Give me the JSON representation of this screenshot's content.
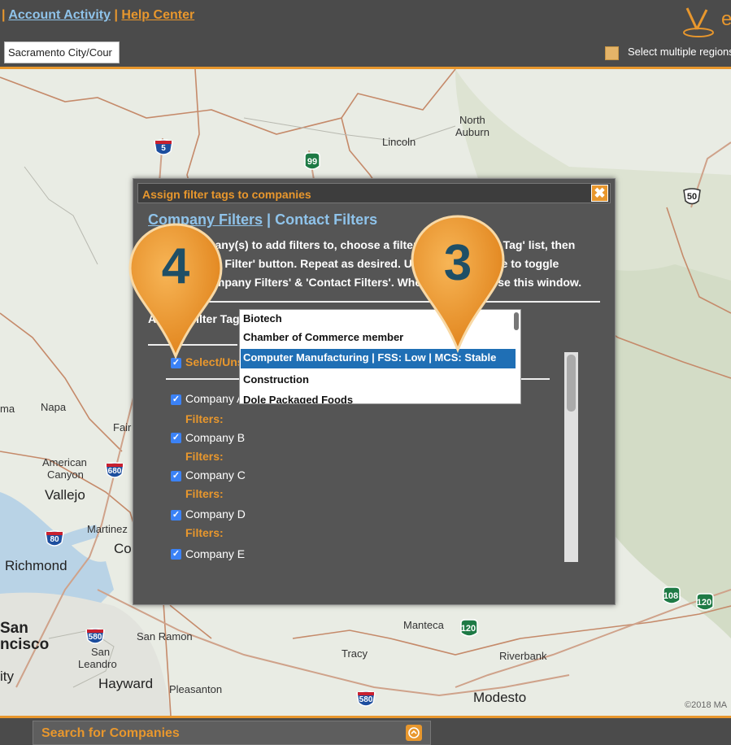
{
  "topbar": {
    "sep1": "|",
    "link_account": "Account Activity",
    "sep2": "|",
    "link_help": "Help Center",
    "region_value": "Sacramento City/Cour",
    "multi_label": "Select multiple regions",
    "logo_letter": "e"
  },
  "map": {
    "labels": {
      "north_auburn_1": "North",
      "north_auburn_2": "Auburn",
      "lincoln": "Lincoln",
      "napa": "Napa",
      "fair": "Fair",
      "american_canyon_1": "American",
      "american_canyon_2": "Canyon",
      "vallejo": "Vallejo",
      "martinez": "Martinez",
      "co": "Co",
      "richmond": "Richmond",
      "san": "San",
      "ncisco": "ncisco",
      "ity": "ity",
      "san_ramon": "San Ramon",
      "san_leandro_1": "San",
      "san_leandro_2": "Leandro",
      "hayward": "Hayward",
      "pleasanton": "Pleasanton",
      "manteca": "Manteca",
      "tracy": "Tracy",
      "riverbank": "Riverbank",
      "modesto": "Modesto",
      "ma": "ma"
    },
    "shields": {
      "i5": "5",
      "r99": "99",
      "us50": "50",
      "i680": "680",
      "i80": "80",
      "i580a": "580",
      "i580b": "580",
      "r120a": "120",
      "r108": "108",
      "r120b": "120"
    },
    "copyright": "©2018 MA"
  },
  "modal": {
    "title": "Assign filter tags to companies",
    "close_glyph": "✖",
    "tab_company": "Company Filters",
    "tab_sep": " | ",
    "tab_contact": "Contact Filters",
    "instructions": "Select company(s) to add filters to, choose a filter from the 'Filter Tag' list, then click the 'Add Filter' button. Repeat as desired. Use the tabs above to toggle between 'Company Filters' & 'Contact Filters'. When finished, close this window.",
    "assign_label": "Assign Filter Tag:",
    "select_all": "Select/Unselect All",
    "filters_label": "Filters:",
    "companies": [
      "Company A",
      "Company B",
      "Company C",
      "Company D",
      "Company E"
    ],
    "filter_options": [
      "Biotech",
      "Chamber of Commerce member",
      "Computer Manufacturing | FSS: Low | MCS: Stable",
      "Construction",
      "Dole Packaged Foods"
    ],
    "selected_option_index": 2
  },
  "pins": {
    "pin_a": "4",
    "pin_b": "3"
  },
  "bottom": {
    "search_title": "Search for Companies"
  },
  "colors": {
    "accent": "#e8972d",
    "link": "#8fc3ea",
    "dark": "#4b4b4b",
    "selected": "#1f6fb5"
  }
}
